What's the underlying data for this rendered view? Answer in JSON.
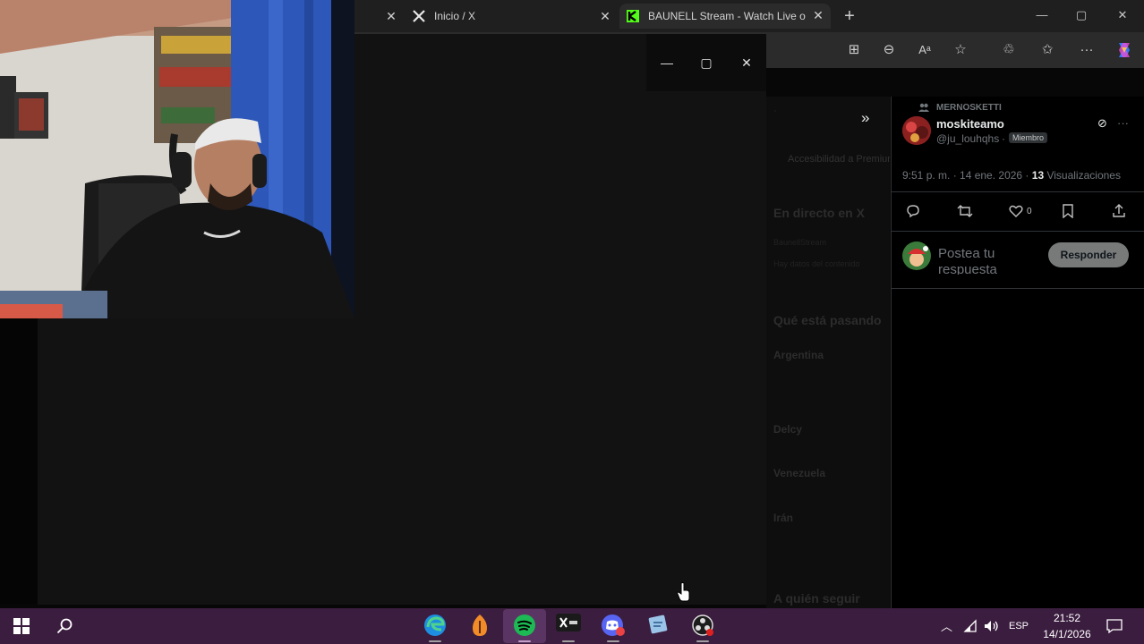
{
  "browser": {
    "tabs": [
      {
        "title": "Inicio / X",
        "active": false
      },
      {
        "title": "BAUNELL Stream - Watch Live on",
        "active": true
      }
    ],
    "new_tab_label": "+",
    "window_controls": {
      "minimize": "—",
      "maximize": "▢",
      "close": "✕"
    }
  },
  "popout": {
    "controls": {
      "minimize": "—",
      "maximize": "▢",
      "close": "✕"
    }
  },
  "community": {
    "name": "MERNOSKETTI"
  },
  "post": {
    "display_name": "moskiteamo",
    "handle": "@ju_louhqhs",
    "separator": "·",
    "badge": "Miembro",
    "timestamp": "9:51 p. m. · 14 ene. 2026 ·",
    "views_count": "13",
    "views_label": "Visualizaciones",
    "like_count": "0",
    "reply_placeholder": "Postea tu respuesta",
    "reply_button": "Responder"
  },
  "background_page": {
    "link": "Accesibilidad a Premium",
    "live_heading": "En directo en X",
    "live_sub": "BaunellStream",
    "live_desc": "Hay datos del contenido",
    "trending_heading": "Qué está pasando",
    "trend_1": "Argentina",
    "trend_2": "Delcy",
    "trend_3": "Venezuela",
    "trend_4": "Irán",
    "follow_heading": "A quién seguir"
  },
  "taskbar": {
    "language": "ESP",
    "time": "21:52",
    "date": "14/1/2026"
  },
  "colors": {
    "taskbar": "#3b1d3f",
    "tab_bar": "#1f1f1f",
    "x_green_logo": "#53fc18",
    "spotify": "#1db954"
  }
}
